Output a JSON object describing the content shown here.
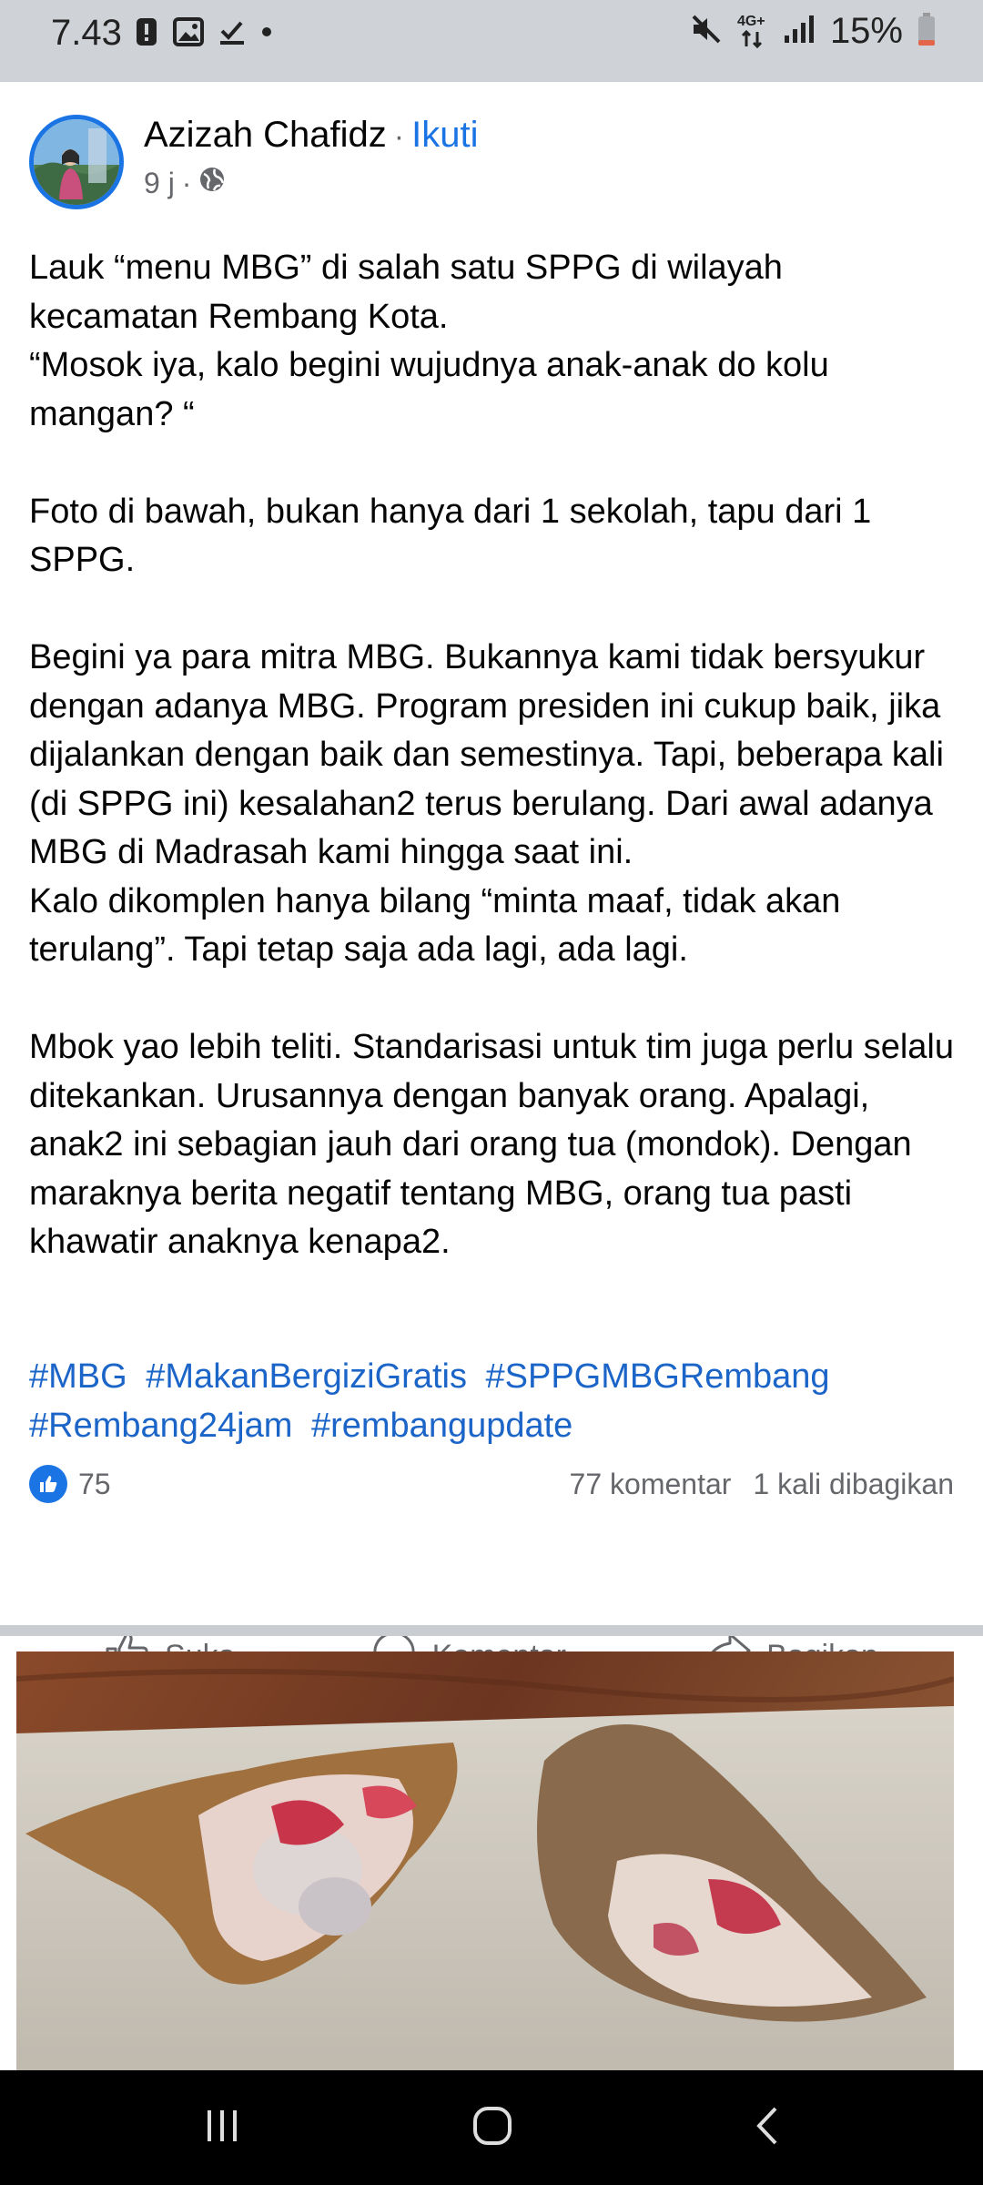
{
  "status_bar": {
    "time": "7.43",
    "battery": "15%",
    "network": "4G+",
    "icons": [
      "alert-icon",
      "image-icon",
      "check-icon",
      "dot-icon",
      "mute-icon",
      "network-icon",
      "signal-icon",
      "battery-icon"
    ]
  },
  "post": {
    "author": "Azizah Chafidz",
    "separator": "·",
    "follow_label": "Ikuti",
    "time": "9 j",
    "meta_separator": "·",
    "privacy_icon": "globe-icon",
    "paragraphs": [
      "Lauk “menu MBG” di salah satu SPPG di wilayah kecamatan Rembang Kota.\n“Mosok iya, kalo begini wujudnya anak-anak do kolu mangan? “",
      "Foto di bawah, bukan hanya dari 1 sekolah, tapu dari 1 SPPG.",
      "Begini ya para mitra MBG. Bukannya kami tidak bersyukur dengan adanya MBG. Program presiden ini cukup baik, jika dijalankan dengan baik dan semestinya. Tapi, beberapa kali (di SPPG ini) kesalahan2 terus berulang. Dari awal adanya MBG di Madrasah kami hingga saat ini.\nKalo dikomplen hanya bilang “minta maaf, tidak akan terulang”. Tapi tetap saja ada lagi, ada lagi.",
      "Mbok yao lebih teliti. Standarisasi untuk tim juga perlu selalu ditekankan. Urusannya dengan banyak orang. Apalagi, anak2 ini sebagian jauh dari orang tua (mondok). Dengan maraknya berita negatif tentang MBG, orang tua pasti khawatir anaknya kenapa2."
    ],
    "hashtags": [
      "#MBG",
      "#MakanBergiziGratis",
      "#SPPGMBGRembang",
      "#Rembang24jam",
      "#rembangupdate"
    ],
    "reaction_count": "75",
    "comments": "77 komentar",
    "shares": "1 kali dibagikan",
    "actions": {
      "like": "Suka",
      "comment": "Komentar",
      "share": "Bagikan"
    }
  },
  "colors": {
    "accent": "#1b74e4",
    "hashtag": "#1b64c8",
    "muted": "#65676b",
    "status_bar_bg": "#cfd2d7"
  }
}
